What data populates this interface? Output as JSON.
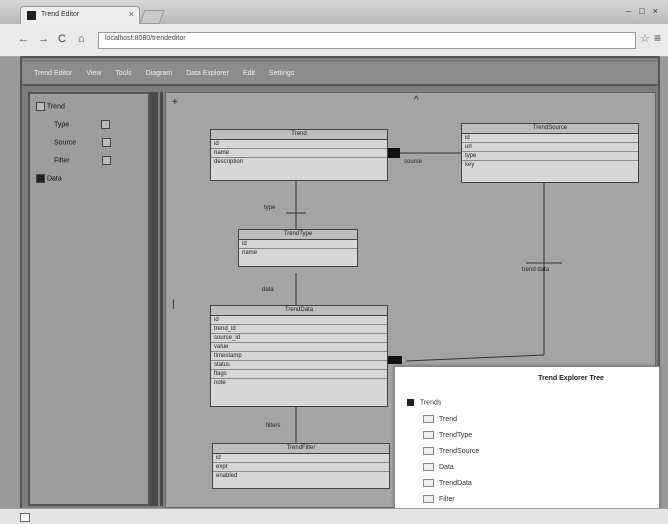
{
  "browser": {
    "tab_title": "Trend Editor",
    "tab_close": "×",
    "window_controls": [
      "–",
      "□",
      "×"
    ],
    "back_icon": "←",
    "forward_icon": "→",
    "reload_icon": "C",
    "home_icon": "⌂",
    "url": "localhost:8080/trendeditor",
    "star_icon": "☆",
    "menu_icon": "≡"
  },
  "menubar": {
    "items": [
      "Trend Editor",
      "View",
      "Tools",
      "Diagram",
      "Data Explorer",
      "Edit",
      "Settings"
    ]
  },
  "left_panel": {
    "rows": [
      {
        "label": "Trend",
        "checked": false
      },
      {
        "label": "Type",
        "checked": false
      },
      {
        "label": "Source",
        "checked": false
      },
      {
        "label": "Filter",
        "checked": false
      },
      {
        "label": "Data",
        "checked": true
      }
    ]
  },
  "canvas": {
    "corner_top_left": "+",
    "corner_top_right": "^",
    "side_marker": "|",
    "entities": [
      {
        "title": "Trend",
        "rows": [
          "id",
          "name",
          "description"
        ]
      },
      {
        "title": "TrendSource",
        "rows": [
          "id",
          "url",
          "type",
          "key"
        ]
      },
      {
        "title": "TrendType",
        "rows": [
          "id",
          "name"
        ]
      },
      {
        "title": "TrendData",
        "rows": [
          "id",
          "trend_id",
          "source_id",
          "value",
          "timestamp",
          "status",
          "flags",
          "note"
        ]
      },
      {
        "title": "TrendFilter",
        "rows": [
          "id",
          "expr",
          "enabled"
        ]
      }
    ],
    "links": [
      {
        "label": "source"
      },
      {
        "label": "type"
      },
      {
        "label": "data"
      },
      {
        "label": "trend data"
      },
      {
        "label": "filters"
      }
    ]
  },
  "tree_panel": {
    "title": "Trend Explorer Tree",
    "root": "Trends",
    "items": [
      "Trend",
      "TrendType",
      "TrendSource",
      "Data",
      "TrendData",
      "Filter"
    ]
  }
}
